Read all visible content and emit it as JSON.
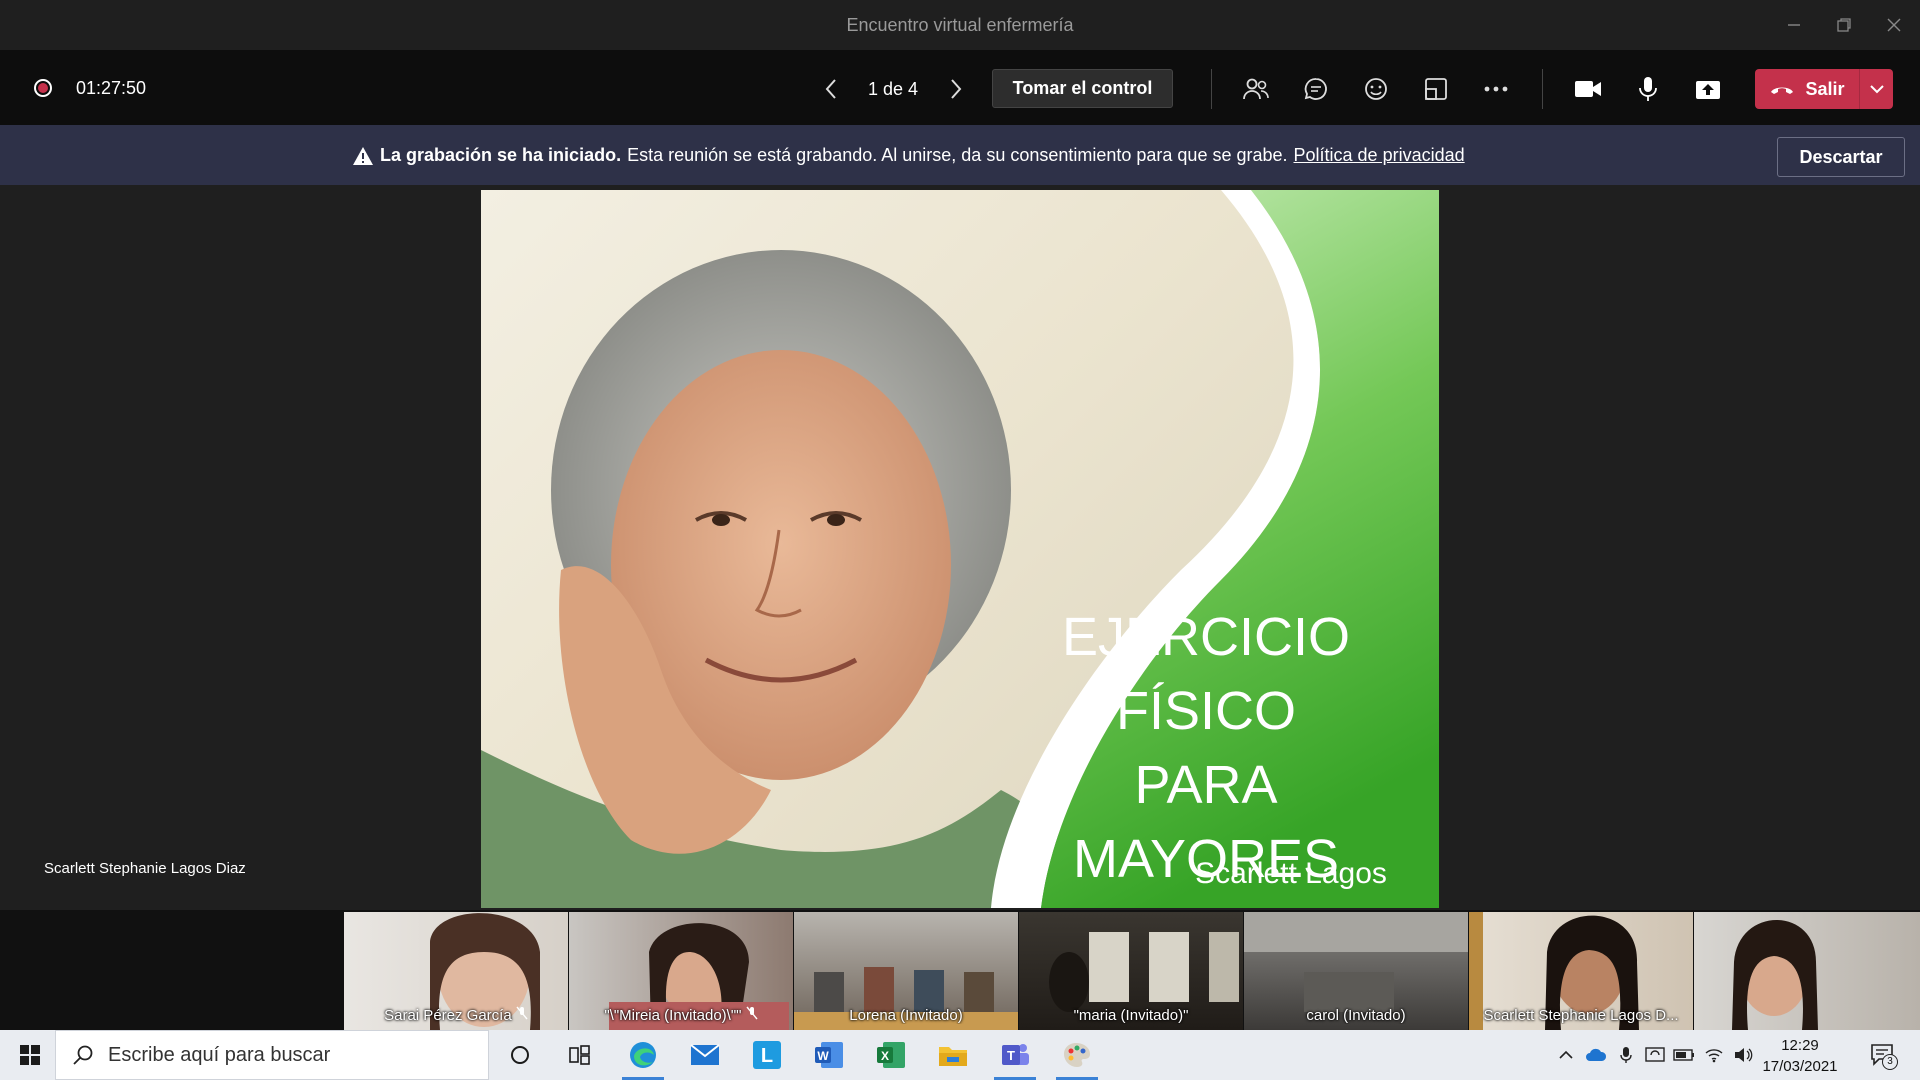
{
  "window": {
    "title": "Encuentro virtual enfermería"
  },
  "toolbar": {
    "timer": "01:27:50",
    "page_indicator": "1 de 4",
    "take_control_label": "Tomar el control",
    "leave_label": "Salir"
  },
  "banner": {
    "title": "La grabación se ha iniciado.",
    "message": "Esta reunión se está grabando. Al unirse, da su consentimiento para que se grabe.",
    "link": "Política de privacidad",
    "dismiss_label": "Descartar"
  },
  "stage": {
    "presenter_name": "Scarlett Stephanie Lagos Diaz",
    "slide": {
      "title_lines": [
        "EJERCICIO",
        "FÍSICO PARA",
        "MAYORES"
      ],
      "author": "Scarlett Lagos"
    }
  },
  "participants": [
    {
      "name": "Sarai Pérez García",
      "muted": true
    },
    {
      "name": "\"\\\"Mireia (Invitado)\\\"\"",
      "muted": true
    },
    {
      "name": "Lorena (Invitado)",
      "muted": false
    },
    {
      "name": "\"maria (Invitado)\"",
      "muted": false
    },
    {
      "name": "carol (Invitado)",
      "muted": false
    },
    {
      "name": "Scarlett Stephanie Lagos D...",
      "muted": false
    },
    {
      "name": "",
      "muted": false
    }
  ],
  "taskbar": {
    "search_placeholder": "Escribe aquí para buscar",
    "time": "12:29",
    "date": "17/03/2021",
    "notification_count": "3"
  },
  "colors": {
    "accent_red": "#c4314b",
    "banner_bg": "#2e3148",
    "slide_green": "#3aaa2a"
  }
}
